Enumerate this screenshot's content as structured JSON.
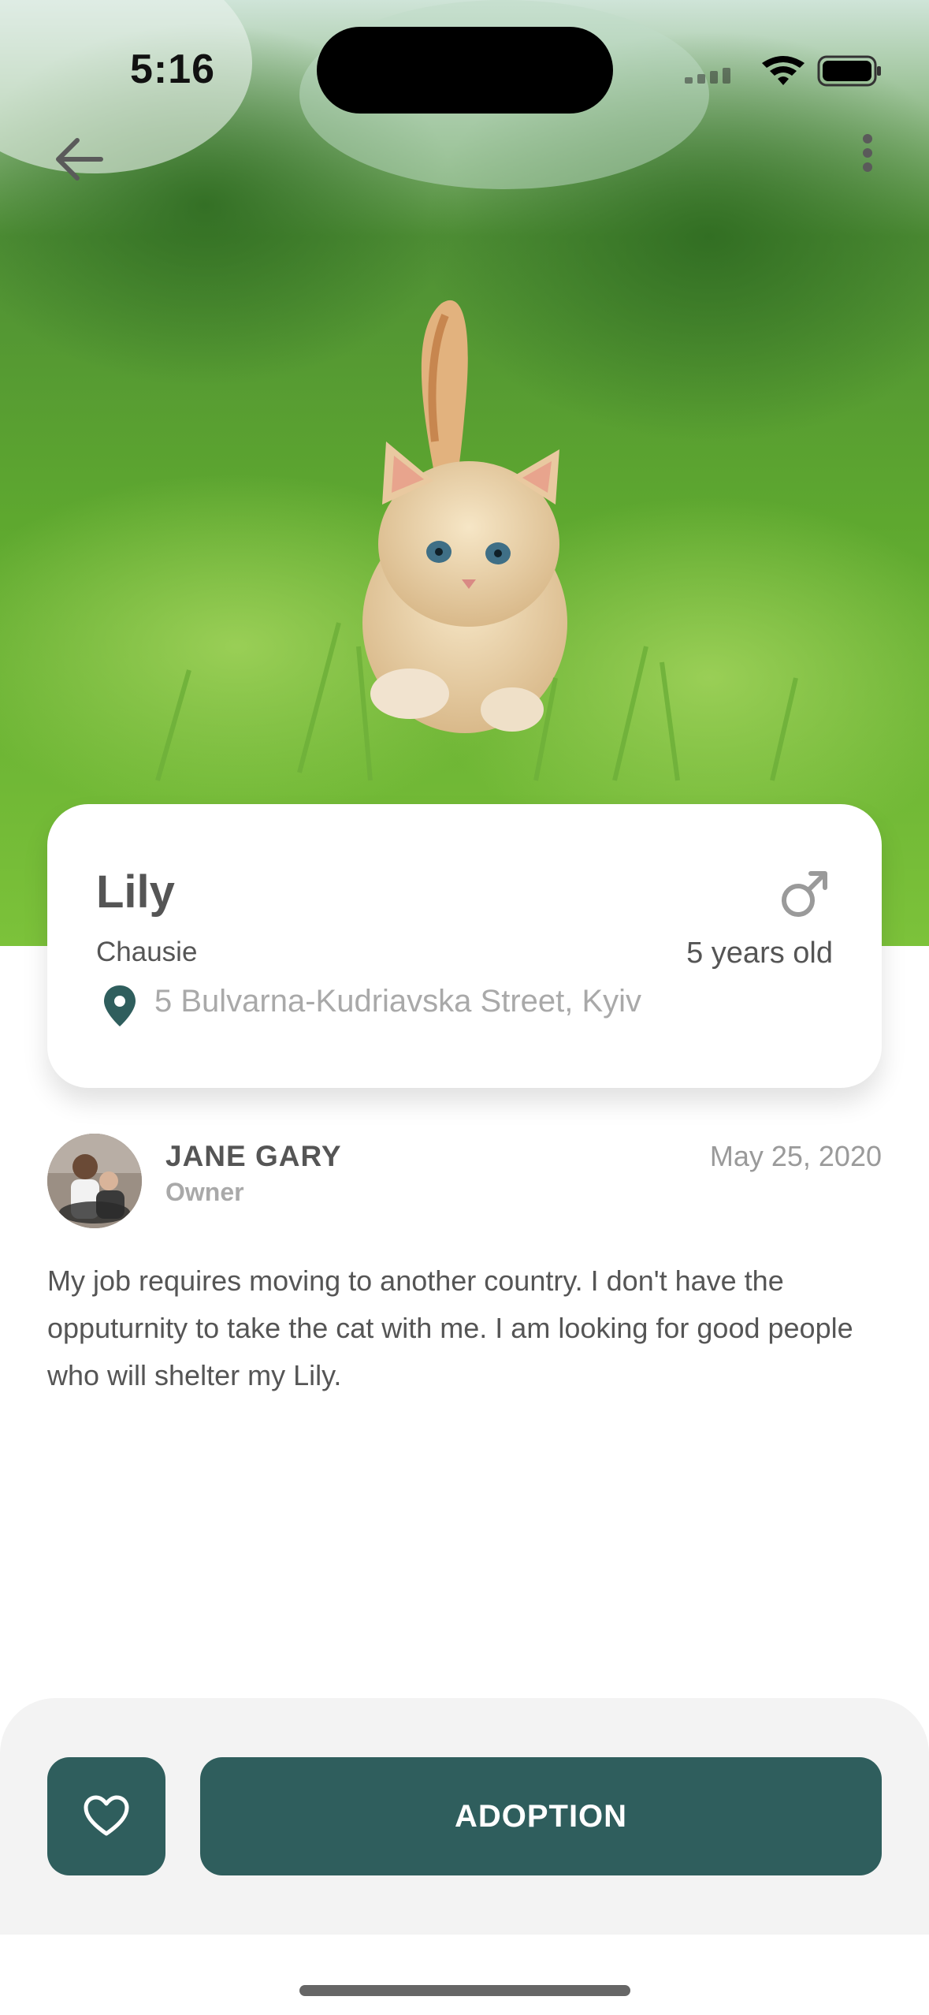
{
  "status_bar": {
    "time": "5:16"
  },
  "pet": {
    "name": "Lily",
    "breed": "Chausie",
    "age": "5 years old",
    "address": "5 Bulvarna-Kudriavska Street, Kyiv",
    "gender_icon": "male-icon"
  },
  "owner": {
    "name": "JANE GARY",
    "role": "Owner",
    "date": "May 25, 2020"
  },
  "story": "My job requires moving to another country. I don't have the opputurnity to take the cat with me. I am looking for good people who will shelter my Lily.",
  "actions": {
    "favorite_icon": "heart-icon",
    "adopt_label": "ADOPTION"
  },
  "colors": {
    "accent": "#2f5e5d",
    "text": "#555555",
    "muted": "#a9a9a9"
  }
}
